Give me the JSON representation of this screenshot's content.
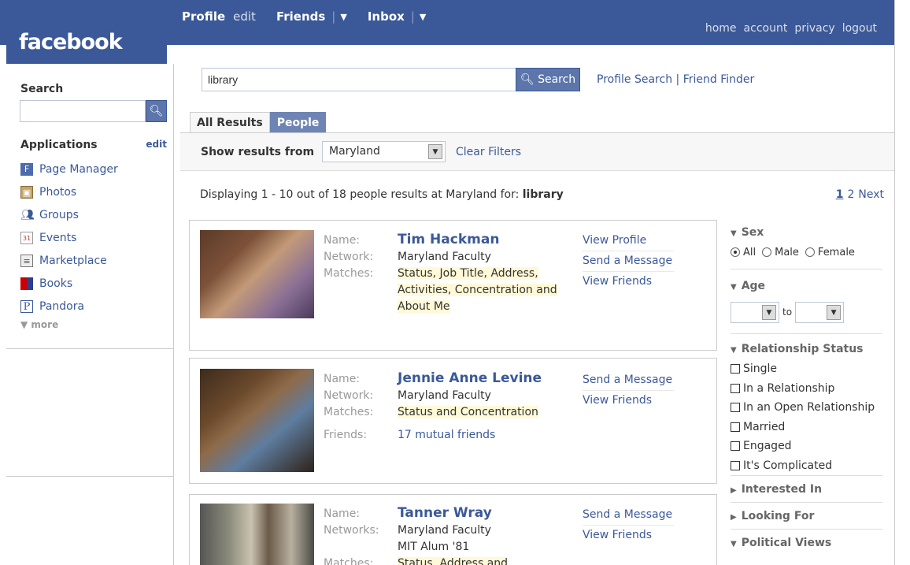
{
  "top": {
    "logo": "facebook",
    "profile": "Profile",
    "edit": "edit",
    "friends": "Friends",
    "inbox": "Inbox",
    "right_links": [
      "home",
      "account",
      "privacy",
      "logout"
    ]
  },
  "sidebar": {
    "search_label": "Search",
    "apps_title": "Applications",
    "apps_edit": "edit",
    "items": [
      {
        "label": "Page Manager",
        "icon": "page-manager-icon"
      },
      {
        "label": "Photos",
        "icon": "photos-icon"
      },
      {
        "label": "Groups",
        "icon": "groups-icon"
      },
      {
        "label": "Events",
        "icon": "events-icon"
      },
      {
        "label": "Marketplace",
        "icon": "marketplace-icon"
      },
      {
        "label": "Books",
        "icon": "books-icon"
      },
      {
        "label": "Pandora",
        "icon": "pandora-icon"
      }
    ],
    "more": "▼ more"
  },
  "search": {
    "query": "library",
    "button": "Search",
    "links": "Profile Search | Friend Finder"
  },
  "tabs": {
    "all": "All Results",
    "people": "People"
  },
  "filter": {
    "label": "Show results from",
    "network": "Maryland",
    "clear": "Clear Filters"
  },
  "display": {
    "prefix": "Displaying 1 - 10 out of 18 people results at Maryland for:",
    "query": "library",
    "page1": "1",
    "page2": "2",
    "next": "Next"
  },
  "results": [
    {
      "name": "Tim Hackman",
      "label_name": "Name:",
      "label_network": "Network:",
      "network": "Maryland Faculty",
      "label_matches": "Matches:",
      "matches_l1": "Status, Job Title, Address,",
      "matches_l2": "Activities, Concentration and",
      "matches_l3": "About Me",
      "actions": [
        "View Profile",
        "Send a Message",
        "View Friends"
      ]
    },
    {
      "name": "Jennie Anne Levine",
      "label_name": "Name:",
      "label_network": "Network:",
      "network": "Maryland Faculty",
      "label_matches": "Matches:",
      "matches_l1": "Status and Concentration",
      "label_friends": "Friends:",
      "friends": "17 mutual friends",
      "actions": [
        "Send a Message",
        "View Friends"
      ]
    },
    {
      "name": "Tanner Wray",
      "label_name": "Name:",
      "label_network": "Networks:",
      "network": "Maryland Faculty",
      "network2": "MIT Alum '81",
      "label_matches": "Matches:",
      "matches_l1": "Status, Address and",
      "actions": [
        "Send a Message",
        "View Friends"
      ]
    }
  ],
  "refine": {
    "sex": "Sex",
    "sex_all": "All",
    "sex_male": "Male",
    "sex_female": "Female",
    "age": "Age",
    "age_to": "to",
    "rel": "Relationship Status",
    "rel_options": [
      "Single",
      "In a Relationship",
      "In an Open Relationship",
      "Married",
      "Engaged",
      "It's Complicated"
    ],
    "interested": "Interested In",
    "looking": "Looking For",
    "political": "Political Views"
  }
}
